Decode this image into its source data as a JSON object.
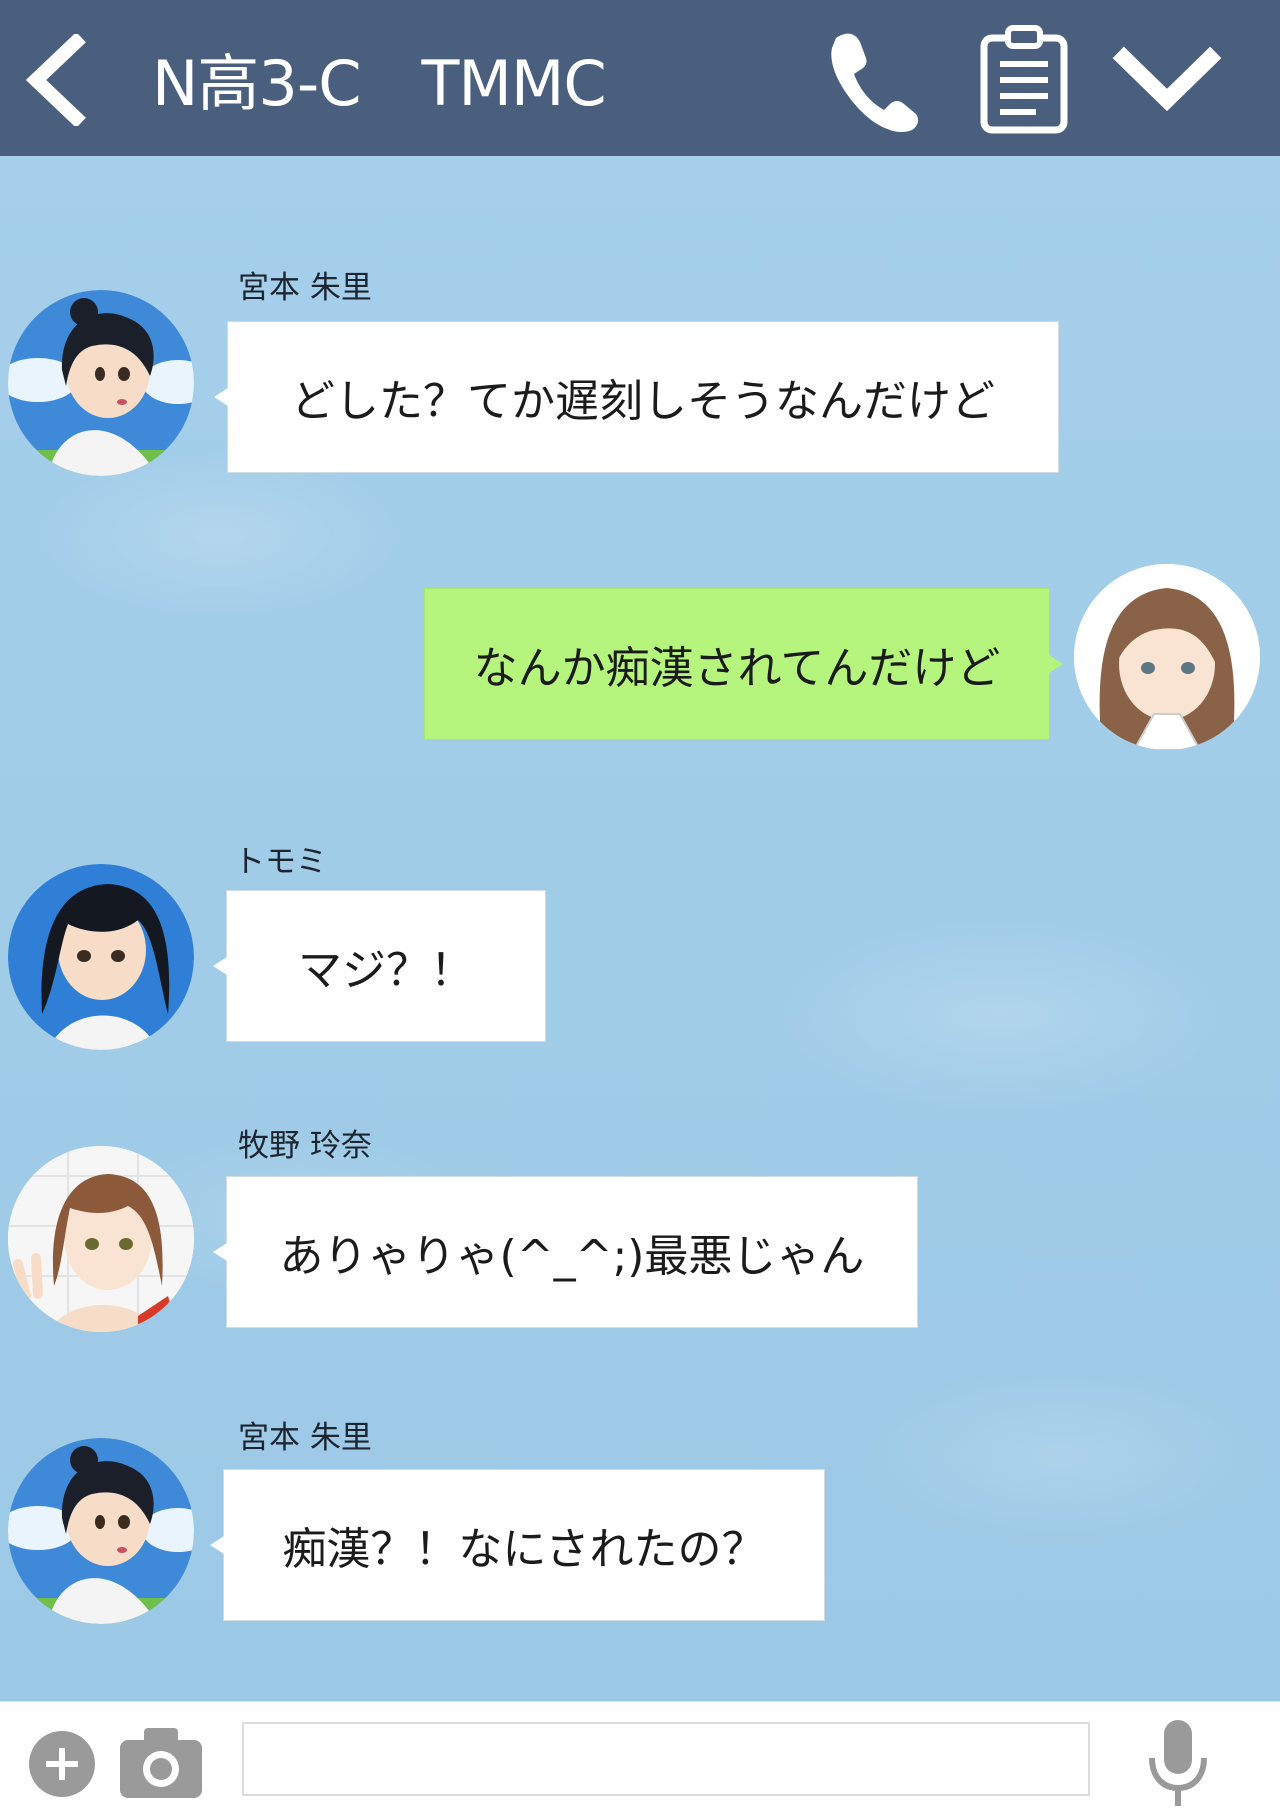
{
  "header": {
    "title": "N高3-C　TMMC",
    "back_icon": "chevron-left-icon",
    "call_icon": "phone-icon",
    "notes_icon": "clipboard-icon",
    "menu_icon": "chevron-down-icon",
    "background": "#4a5f7e"
  },
  "chat": {
    "background": "#9fcbe6",
    "messages": [
      {
        "side": "left",
        "sender": "宮本 朱里",
        "text": "どした？てか遅刻しそうなんだけど",
        "avatar": "akari-avatar"
      },
      {
        "side": "right",
        "sender": "",
        "text": "なんか痴漢されてんだけど",
        "avatar": "self-avatar"
      },
      {
        "side": "left",
        "sender": "トモミ",
        "text": "マジ？！",
        "avatar": "tomomi-avatar"
      },
      {
        "side": "left",
        "sender": "牧野 玲奈",
        "text": "ありゃりゃ(^_^;)最悪じゃん",
        "avatar": "rena-avatar"
      },
      {
        "side": "left",
        "sender": "宮本 朱里",
        "text": "痴漢？！なにされたの？",
        "avatar": "akari-avatar"
      }
    ]
  },
  "footer": {
    "plus_icon": "plus-circle-icon",
    "camera_icon": "camera-icon",
    "mic_icon": "microphone-icon",
    "input_value": "",
    "input_placeholder": ""
  },
  "colors": {
    "outgoing_bubble": "#b5f57e",
    "incoming_bubble": "#ffffff"
  }
}
